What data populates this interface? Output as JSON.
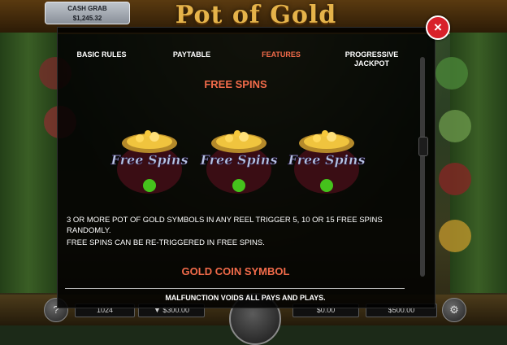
{
  "game": {
    "logo": "Pot of Gold",
    "cash_grab_label": "CASH GRAB",
    "cash_grab_value": "$1,245.32"
  },
  "bottom_bar": {
    "help": "?",
    "lines": "1024",
    "bet": "▼ $300.00",
    "win": "$0.00",
    "balance": "$500.00",
    "settings": "⚙"
  },
  "modal": {
    "close": "×",
    "tabs": [
      {
        "label": "BASIC RULES"
      },
      {
        "label": "PAYTABLE"
      },
      {
        "label": "FEATURES"
      },
      {
        "label": "PROGRESSIVE JACKPOT"
      }
    ],
    "active_tab": "FEATURES",
    "free_spins": {
      "title": "FREE SPINS",
      "symbol_text": "Free Spins",
      "line1": "3 OR MORE POT OF GOLD SYMBOLS IN ANY REEL TRIGGER 5, 10 OR 15 FREE SPINS RANDOMLY.",
      "line2": "FREE SPINS CAN BE RE-TRIGGERED IN FREE SPINS."
    },
    "gold_coin": {
      "title": "GOLD COIN SYMBOL"
    },
    "malfunction": "MALFUNCTION VOIDS ALL PAYS AND PLAYS."
  },
  "colors": {
    "accent": "#f26b4a",
    "close_red": "#d8202a",
    "gold": "#e5b34a"
  }
}
